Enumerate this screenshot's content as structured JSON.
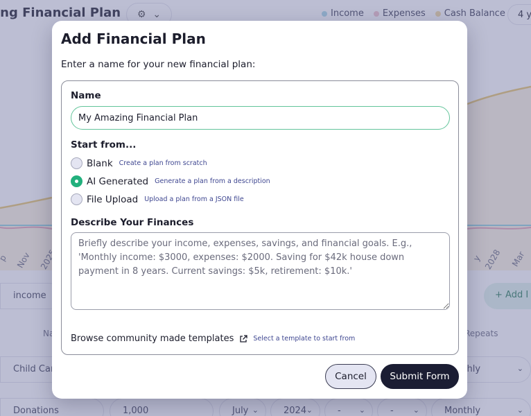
{
  "background": {
    "plan_title": "ing Financial Plan",
    "legend": [
      {
        "label": "Income",
        "color": "#a8d8e8"
      },
      {
        "label": "Expenses",
        "color": "#f0c2cc"
      },
      {
        "label": "Cash Balance",
        "color": "#f2d9a0"
      }
    ],
    "years_selector": "4 y",
    "x_ticks": [
      "p",
      "Nov",
      "2025",
      "y",
      "2028",
      "Mar"
    ],
    "search_value": "income",
    "add_button": "+ Add I",
    "columns": {
      "name": "Na",
      "repeats": "Repeats"
    },
    "rows": [
      {
        "name": "Child Car",
        "frequency": "Monthly"
      },
      {
        "name": "Donations",
        "amount": "1,000",
        "month": "July",
        "year": "2024",
        "blank1": "-",
        "blank2": "-",
        "frequency": "Monthly"
      }
    ]
  },
  "modal": {
    "title": "Add Financial Plan",
    "subtitle": "Enter a name for your new financial plan:",
    "name_label": "Name",
    "name_value": "My Amazing Financial Plan",
    "start_label": "Start from...",
    "options": [
      {
        "label": "Blank",
        "description": "Create a plan from scratch",
        "selected": false
      },
      {
        "label": "AI Generated",
        "description": "Generate a plan from a description",
        "selected": true
      },
      {
        "label": "File Upload",
        "description": "Upload a plan from a JSON file",
        "selected": false
      }
    ],
    "describe_label": "Describe Your Finances",
    "describe_placeholder": "Briefly describe your income, expenses, savings, and financial goals. E.g., 'Monthly income: $3000, expenses: $2000. Saving for $42k house down payment in 8 years. Current savings: $5k, retirement: $10k.'",
    "browse_link": "Browse community made templates",
    "browse_hint": "Select a template to start from",
    "cancel_label": "Cancel",
    "submit_label": "Submit Form",
    "accent_color": "#22b07d"
  }
}
